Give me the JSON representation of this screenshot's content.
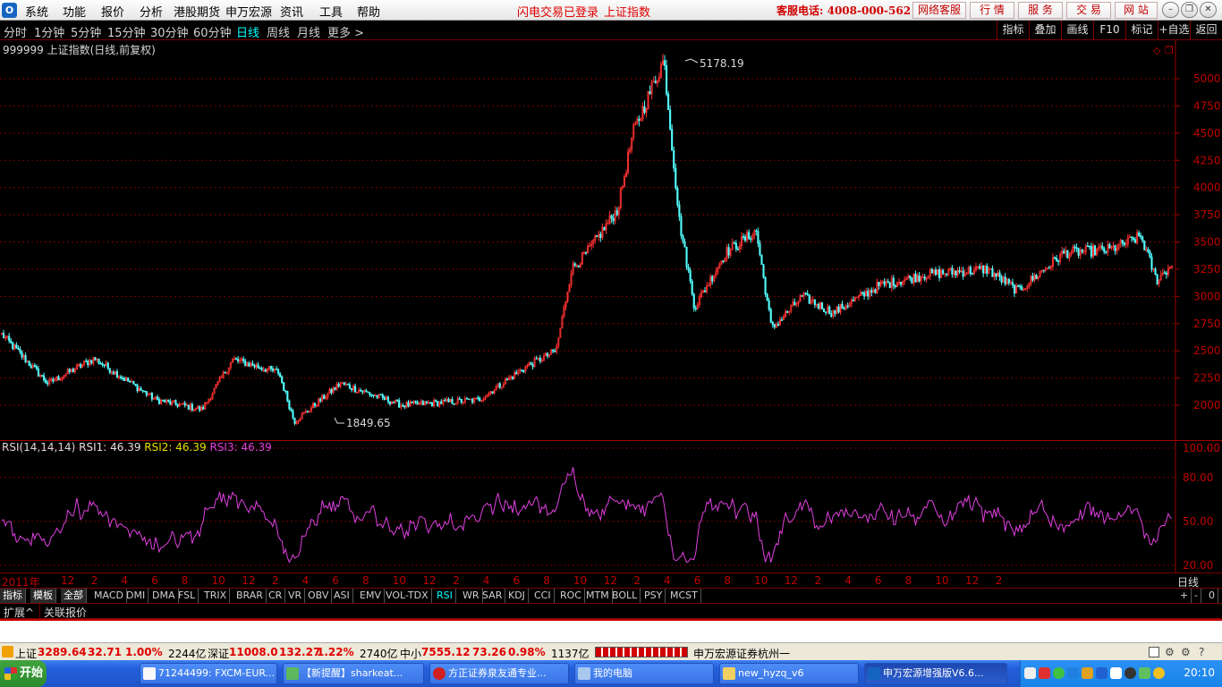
{
  "menubar": {
    "logo": "O",
    "items": [
      "系统",
      "功能",
      "报价",
      "分析",
      "港股期货",
      "申万宏源",
      "资讯",
      "工具",
      "帮助"
    ],
    "login_status": "闪电交易已登录",
    "current_index": "上证指数",
    "hotline": "客服电话: 4008-000-562",
    "right_buttons": [
      "网络客服",
      "行 情",
      "服 务",
      "交 易",
      "网 站"
    ]
  },
  "periods": {
    "items": [
      "分时",
      "1分钟",
      "5分钟",
      "15分钟",
      "30分钟",
      "60分钟",
      "日线",
      "周线",
      "月线",
      "更多 >"
    ],
    "active": "日线"
  },
  "toolbar": {
    "items": [
      "指标",
      "叠加",
      "画线",
      "F10",
      "标记",
      "+自选",
      "返回"
    ]
  },
  "chart_title": "999999 上证指数(日线,前复权)",
  "price_annotations": {
    "high_label": "5178.19",
    "low_label": "1849.65"
  },
  "price_axis": [
    "5000",
    "4750",
    "4500",
    "4250",
    "4000",
    "3750",
    "3500",
    "3250",
    "3000",
    "2750",
    "2500",
    "2250",
    "2000"
  ],
  "rsi": {
    "legend_prefix": "RSI(14,14,14)",
    "rsi1_label": "RSI1: 46.39",
    "rsi2_label": "RSI2: 46.39",
    "rsi3_label": "RSI3: 46.39",
    "axis": [
      "100.00",
      "80.00",
      "50.00",
      "20.00"
    ]
  },
  "time_axis": {
    "first": "2011年",
    "months": [
      "12",
      "2",
      "4",
      "6",
      "8",
      "10",
      "12",
      "2",
      "4",
      "6",
      "8",
      "10",
      "12",
      "2",
      "4",
      "6",
      "8",
      "10",
      "12",
      "2",
      "4",
      "6",
      "8",
      "10",
      "12",
      "2",
      "4",
      "6",
      "8",
      "10",
      "12",
      "2"
    ],
    "period_label": "日线"
  },
  "indicator_tabs": {
    "items": [
      "指标",
      "模板",
      "全部",
      "MACD",
      "DMI",
      "DMA",
      "FSL",
      "TRIX",
      "BRAR",
      "CR",
      "VR",
      "OBV",
      "ASI",
      "EMV",
      "VOL-TDX",
      "RSI",
      "WR",
      "SAR",
      "KDJ",
      "CCI",
      "ROC",
      "MTM",
      "BOLL",
      "PSY",
      "MCST"
    ],
    "active": "RSI",
    "right": [
      "+",
      "-",
      "0"
    ]
  },
  "ext_bar": {
    "items": [
      "扩展^",
      "关联报价"
    ]
  },
  "status": {
    "sh_name": "上证",
    "sh_value": "3289.64",
    "sh_change": "32.71",
    "sh_pct": "1.00%",
    "sh_amount": "2244亿",
    "sz_name": "深证",
    "sz_value": "11008.0",
    "sz_change": "132.27",
    "sz_pct": "1.22%",
    "sz_amount": "2740亿",
    "zx_name": "中小",
    "zx_value": "7555.12",
    "zx_change": "73.26",
    "zx_pct": "0.98%",
    "zx_amount": "1137亿",
    "broker": "申万宏源证券杭州一"
  },
  "taskbar": {
    "start": "开始",
    "tasks": [
      "71244499: FXCM-EUR...",
      "【新提醒】sharkeat...",
      "方正证券泉友通专业...",
      "我的电脑",
      "new_hyzq_v6",
      "申万宏源增强版V6.6..."
    ],
    "clock": "20:10"
  },
  "chart_data": {
    "type": "candlestick",
    "title": "999999 上证指数(日线,前复权)",
    "x_range": [
      "2011-12",
      "2017-02"
    ],
    "ylim": [
      1800,
      5250
    ],
    "keypoints": [
      {
        "x": "2011-11",
        "y": 2650
      },
      {
        "x": "2012-02",
        "y": 2200
      },
      {
        "x": "2012-05",
        "y": 2430
      },
      {
        "x": "2012-09",
        "y": 2050
      },
      {
        "x": "2012-12",
        "y": 1960
      },
      {
        "x": "2013-02",
        "y": 2420
      },
      {
        "x": "2013-05",
        "y": 2300
      },
      {
        "x": "2013-06",
        "y": 1849.65
      },
      {
        "x": "2013-09",
        "y": 2200
      },
      {
        "x": "2014-01",
        "y": 2000
      },
      {
        "x": "2014-06",
        "y": 2050
      },
      {
        "x": "2014-09",
        "y": 2350
      },
      {
        "x": "2014-11",
        "y": 2500
      },
      {
        "x": "2014-12",
        "y": 3250
      },
      {
        "x": "2015-01",
        "y": 3400
      },
      {
        "x": "2015-03",
        "y": 3800
      },
      {
        "x": "2015-04",
        "y": 4500
      },
      {
        "x": "2015-06",
        "y": 5178.19
      },
      {
        "x": "2015-07",
        "y": 3700
      },
      {
        "x": "2015-08",
        "y": 2900
      },
      {
        "x": "2015-10",
        "y": 3400
      },
      {
        "x": "2015-12",
        "y": 3600
      },
      {
        "x": "2016-01",
        "y": 2700
      },
      {
        "x": "2016-03",
        "y": 3000
      },
      {
        "x": "2016-05",
        "y": 2850
      },
      {
        "x": "2016-08",
        "y": 3100
      },
      {
        "x": "2016-11",
        "y": 3200
      },
      {
        "x": "2017-03",
        "y": 3250
      },
      {
        "x": "2017-05",
        "y": 3050
      },
      {
        "x": "2017-08",
        "y": 3400
      },
      {
        "x": "2017-11",
        "y": 3430
      },
      {
        "x": "2018-01",
        "y": 3550
      },
      {
        "x": "2018-02",
        "y": 3150
      },
      {
        "x": "2018-03",
        "y": 3290
      }
    ],
    "rsi_range": [
      20,
      100
    ]
  }
}
